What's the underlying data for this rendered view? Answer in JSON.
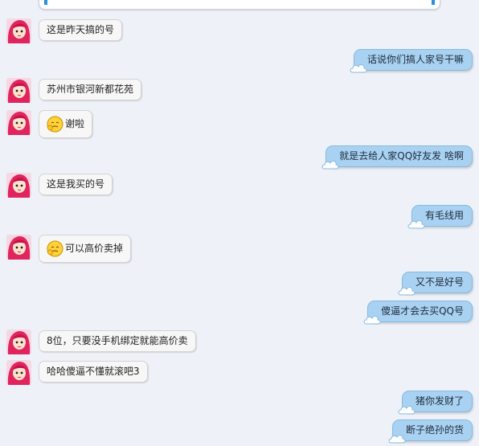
{
  "messages": [
    {
      "side": "in",
      "text": "这是昨天搞的号"
    },
    {
      "side": "out",
      "text": "话说你们搞人家号干嘛"
    },
    {
      "side": "in",
      "text": "苏州市银河新都花苑"
    },
    {
      "side": "in",
      "text": "谢啦",
      "emoji": "embarrassed-emoji"
    },
    {
      "side": "out",
      "text": "就是去给人家QQ好友发  啥啊"
    },
    {
      "side": "in",
      "text": "这是我买的号"
    },
    {
      "side": "out",
      "text": "有毛线用"
    },
    {
      "side": "in",
      "text": "可以高价卖掉",
      "emoji": "embarrassed-emoji"
    },
    {
      "side": "out",
      "text": "又不是好号"
    },
    {
      "side": "out",
      "text": "傻逼才会去买QQ号"
    },
    {
      "side": "in",
      "text": "8位，只要没手机绑定就能高价卖"
    },
    {
      "side": "in",
      "text": "哈哈傻逼不懂就滚吧3"
    },
    {
      "side": "out",
      "text": "猪你发财了"
    },
    {
      "side": "out",
      "text": "断子绝孙的货"
    }
  ],
  "colors": {
    "background": "#eef1f7",
    "incoming_bubble": "#f7f7f7",
    "outgoing_bubble": "#a9d2f2",
    "avatar_hair": "#e0245e"
  }
}
